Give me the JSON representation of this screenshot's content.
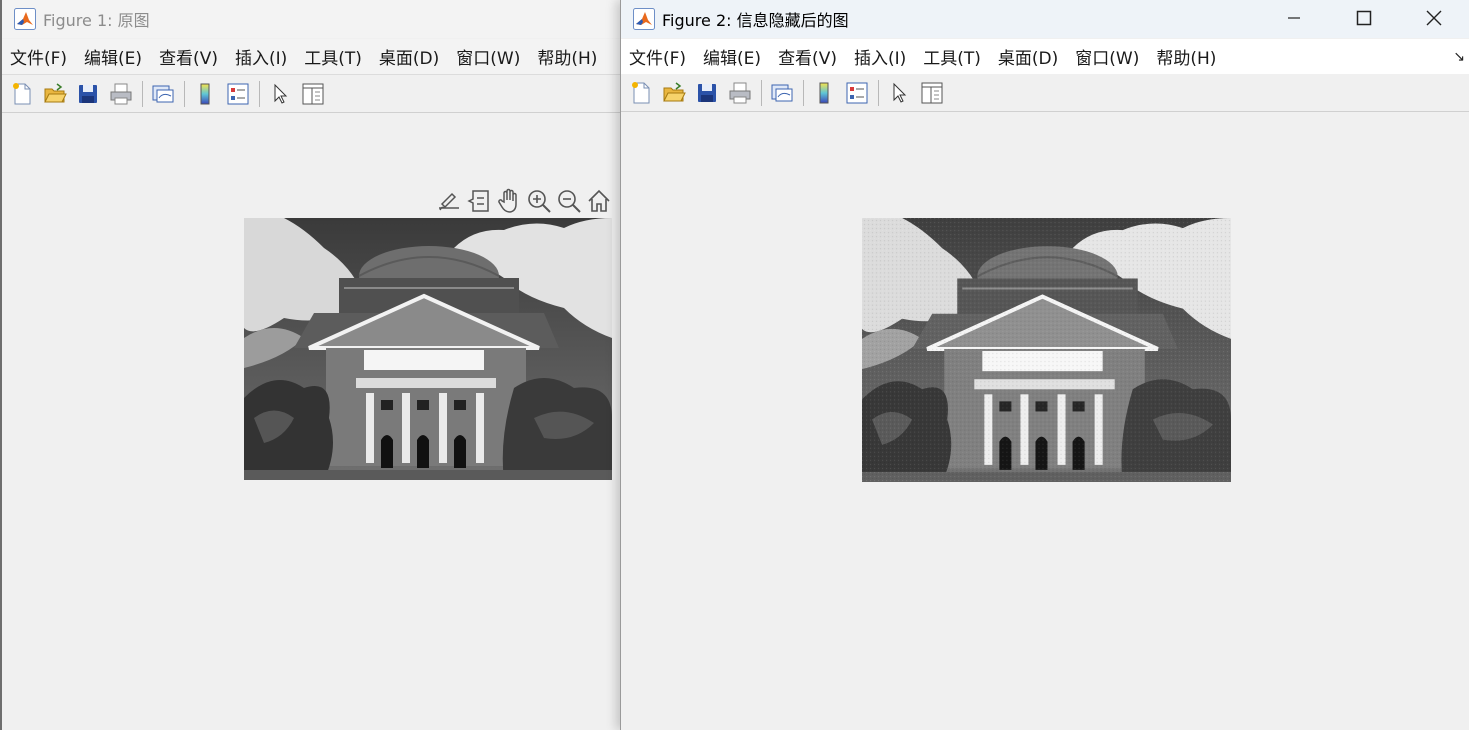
{
  "windows": {
    "figure1": {
      "title": "Figure 1: 原图",
      "active": false,
      "menu": [
        "文件(F)",
        "编辑(E)",
        "查看(V)",
        "插入(I)",
        "工具(T)",
        "桌面(D)",
        "窗口(W)",
        "帮助(H)"
      ],
      "toolbar_icons": [
        "new-figure-icon",
        "open-file-icon",
        "save-icon",
        "print-icon",
        "link-plot-icon",
        "colorbar-icon",
        "legend-icon",
        "edit-plot-icon",
        "property-inspector-icon"
      ],
      "axes_toolbar_icons": [
        "brush-data-icon",
        "data-tips-icon",
        "pan-hand-icon",
        "zoom-in-icon",
        "zoom-out-icon",
        "restore-view-icon"
      ]
    },
    "figure2": {
      "title": "Figure 2: 信息隐藏后的图",
      "active": true,
      "menu": [
        "文件(F)",
        "编辑(E)",
        "查看(V)",
        "插入(I)",
        "工具(T)",
        "桌面(D)",
        "窗口(W)",
        "帮助(H)"
      ],
      "toolbar_icons": [
        "new-figure-icon",
        "open-file-icon",
        "save-icon",
        "print-icon",
        "link-plot-icon",
        "colorbar-icon",
        "legend-icon",
        "edit-plot-icon",
        "property-inspector-icon"
      ],
      "window_controls": [
        "minimize-icon",
        "maximize-icon",
        "close-icon"
      ],
      "menu_overflow": "↘"
    }
  },
  "colors": {
    "matlab_orange": "#e96a1d",
    "matlab_blue": "#2a5bb4",
    "window_bg": "#f0f0f0"
  }
}
